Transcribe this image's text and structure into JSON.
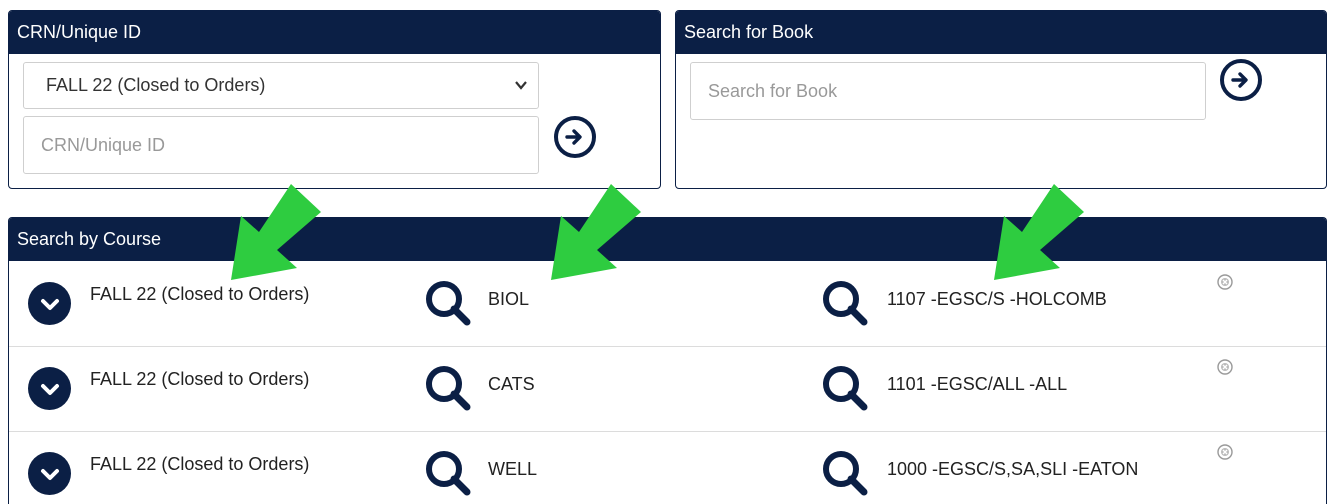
{
  "crn_panel": {
    "title": "CRN/Unique ID",
    "term_selected": "FALL 22 (Closed to Orders)",
    "crn_placeholder": "CRN/Unique ID"
  },
  "book_panel": {
    "title": "Search for Book",
    "placeholder": "Search for Book"
  },
  "course_panel": {
    "title": "Search by Course",
    "rows": [
      {
        "term": "FALL 22 (Closed to Orders)",
        "department": "BIOL",
        "section": "1107 -EGSC/S -HOLCOMB"
      },
      {
        "term": "FALL 22 (Closed to Orders)",
        "department": "CATS",
        "section": "1101 -EGSC/ALL -ALL"
      },
      {
        "term": "FALL 22 (Closed to Orders)",
        "department": "WELL",
        "section": "1000 -EGSC/S,SA,SLI -EATON"
      }
    ]
  },
  "colors": {
    "navy": "#0b1f45",
    "arrow_green": "#2ecc40"
  },
  "icons": {
    "toggle": "chevron-down-circle-icon",
    "search": "magnifier-icon",
    "go": "arrow-right-circle-icon",
    "remove": "close-circle-icon"
  }
}
